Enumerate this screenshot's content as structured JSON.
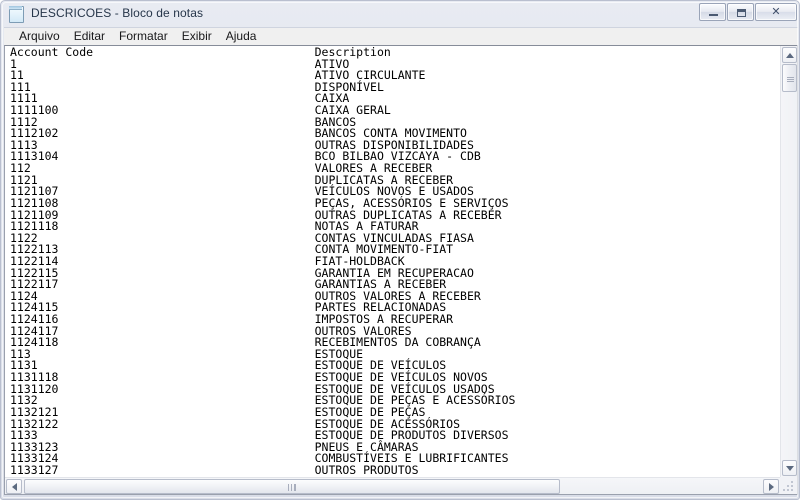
{
  "window": {
    "title": "DESCRICOES - Bloco de notas",
    "icon": "notepad-icon",
    "controls": {
      "minimize_tooltip": "Minimizar",
      "maximize_tooltip": "Maximizar",
      "close_label": "✕"
    },
    "frame_color": "#dfe3ec",
    "titlebar_text_color": "#26354a"
  },
  "menubar": {
    "items": [
      {
        "label": "Arquivo"
      },
      {
        "label": "Editar"
      },
      {
        "label": "Formatar"
      },
      {
        "label": "Exibir"
      },
      {
        "label": "Ajuda"
      }
    ]
  },
  "editor": {
    "background": "#ffffff",
    "text_color": "#000000",
    "header": {
      "code": "Account Code",
      "description": "Description"
    },
    "rows": [
      {
        "code": "1",
        "description": "ATIVO"
      },
      {
        "code": "11",
        "description": "ATIVO CIRCULANTE"
      },
      {
        "code": "111",
        "description": "DISPONÍVEL"
      },
      {
        "code": "1111",
        "description": "CAIXA"
      },
      {
        "code": "1111100",
        "description": "CAIXA GERAL"
      },
      {
        "code": "1112",
        "description": "BANCOS"
      },
      {
        "code": "1112102",
        "description": "BANCOS CONTA MOVIMENTO"
      },
      {
        "code": "1113",
        "description": "OUTRAS DISPONIBILIDADES"
      },
      {
        "code": "1113104",
        "description": "BCO BILBAO VIZCAYA - CDB"
      },
      {
        "code": "112",
        "description": "VALORES A RECEBER"
      },
      {
        "code": "1121",
        "description": "DUPLICATAS A RECEBER"
      },
      {
        "code": "1121107",
        "description": "VEÍCULOS NOVOS E USADOS"
      },
      {
        "code": "1121108",
        "description": "PEÇAS, ACESSÓRIOS E SERVIÇOS"
      },
      {
        "code": "1121109",
        "description": "OUTRAS DUPLICATAS A RECEBER"
      },
      {
        "code": "1121118",
        "description": "NOTAS A FATURAR"
      },
      {
        "code": "1122",
        "description": "CONTAS VINCULADAS FIASA"
      },
      {
        "code": "1122113",
        "description": "CONTA MOVIMENTO-FIAT"
      },
      {
        "code": "1122114",
        "description": "FIAT-HOLDBACK"
      },
      {
        "code": "1122115",
        "description": "GARANTIA EM RECUPERACAO"
      },
      {
        "code": "1122117",
        "description": "GARANTIAS A RECEBER"
      },
      {
        "code": "1124",
        "description": "OUTROS VALORES A RECEBER"
      },
      {
        "code": "1124115",
        "description": "PARTES RELACIONADAS"
      },
      {
        "code": "1124116",
        "description": "IMPOSTOS A RECUPERAR"
      },
      {
        "code": "1124117",
        "description": "OUTROS VALORES"
      },
      {
        "code": "1124118",
        "description": "RECEBIMENTOS DA COBRANÇA"
      },
      {
        "code": "113",
        "description": "ESTOQUE"
      },
      {
        "code": "1131",
        "description": "ESTOQUE DE VEÍCULOS"
      },
      {
        "code": "1131118",
        "description": "ESTOQUE DE VEÍCULOS NOVOS"
      },
      {
        "code": "1131120",
        "description": "ESTOQUE DE VEÍCULOS USADOS"
      },
      {
        "code": "1132",
        "description": "ESTOQUE DE PEÇAS E ACESSÓRIOS"
      },
      {
        "code": "1132121",
        "description": "ESTOQUE DE PEÇAS"
      },
      {
        "code": "1132122",
        "description": "ESTOQUE DE ACESSÓRIOS"
      },
      {
        "code": "1133",
        "description": "ESTOQUE DE PRODUTOS DIVERSOS"
      },
      {
        "code": "1133123",
        "description": "PNEUS E CÂMARAS"
      },
      {
        "code": "1133124",
        "description": "COMBUSTÍVEIS E LUBRIFICANTES"
      },
      {
        "code": "1133127",
        "description": "OUTROS PRODUTOS"
      }
    ],
    "description_column": 44
  },
  "scrollbars": {
    "vertical": {
      "up_arrow": "▲",
      "down_arrow": "▼",
      "thumb_position_percent": 0
    },
    "horizontal": {
      "left_arrow": "◀",
      "right_arrow": "▶",
      "thumb_position_percent": 0
    }
  }
}
